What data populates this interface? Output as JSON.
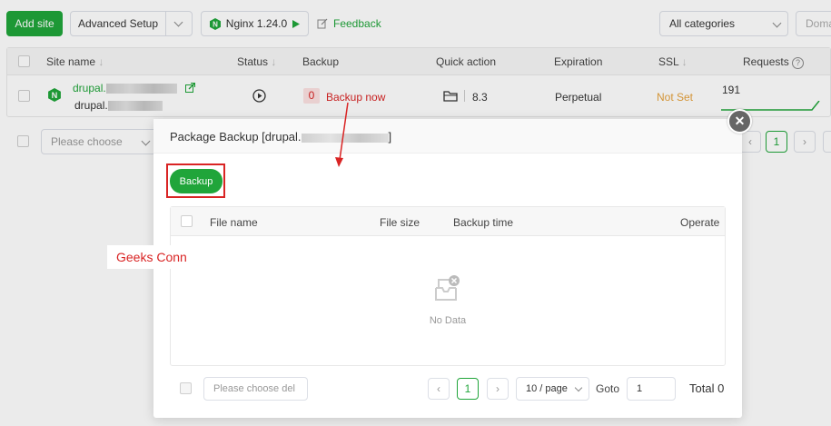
{
  "toolbar": {
    "add_site": "Add site",
    "advanced_setup": "Advanced Setup",
    "nginx": "Nginx 1.24.0",
    "feedback": "Feedback",
    "categories": "All categories",
    "domain_placeholder": "Doma"
  },
  "site_table": {
    "headers": {
      "site_name": "Site name",
      "status": "Status",
      "backup": "Backup",
      "quick_action": "Quick action",
      "expiration": "Expiration",
      "ssl": "SSL",
      "requests": "Requests"
    },
    "row": {
      "name_prefix": "drupal.",
      "remark_prefix": "drupal.",
      "backup_count": "0",
      "backup_now": "Backup now",
      "php": "8.3",
      "expiration": "Perpetual",
      "ssl": "Not Set",
      "requests": "191"
    }
  },
  "page_footer": {
    "choose": "Please choose",
    "page": "1"
  },
  "modal": {
    "title_prefix": "Package Backup [drupal.",
    "title_suffix": "]",
    "backup_button": "Backup",
    "headers": {
      "file_name": "File name",
      "file_size": "File size",
      "backup_time": "Backup time",
      "operate": "Operate"
    },
    "empty_text": "No Data",
    "footer": {
      "choose_del": "Please choose del",
      "page": "1",
      "per_page": "10 / page",
      "goto_label": "Goto",
      "goto_value": "1",
      "total": "Total 0"
    }
  },
  "annotation": {
    "label": "Geeks Conn"
  },
  "colors": {
    "brand_green": "#20a53a",
    "annotation_red": "#d92424",
    "not_set_orange": "#e6a23c"
  }
}
